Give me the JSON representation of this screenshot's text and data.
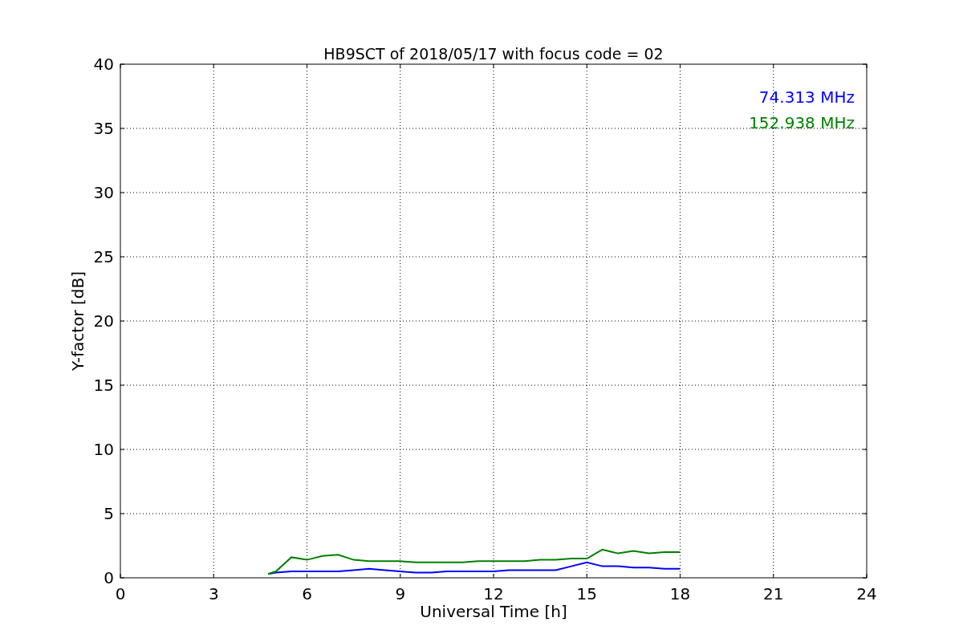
{
  "chart_data": {
    "type": "line",
    "title": "HB9SCT of 2018/05/17 with focus code = 02",
    "xlabel": "Universal Time [h]",
    "ylabel": "Y-factor [dB]",
    "x": [
      4.75,
      5,
      5.5,
      6,
      6.5,
      7,
      7.5,
      8,
      8.5,
      9,
      9.5,
      10,
      10.5,
      11,
      11.5,
      12,
      12.5,
      13,
      13.5,
      14,
      14.5,
      15,
      15.5,
      16,
      16.5,
      17,
      17.5,
      18
    ],
    "series": [
      {
        "name": "74.313 MHz",
        "color": "#0000ff",
        "values": [
          0.3,
          0.4,
          0.5,
          0.5,
          0.5,
          0.5,
          0.6,
          0.7,
          0.6,
          0.5,
          0.4,
          0.4,
          0.5,
          0.5,
          0.5,
          0.5,
          0.6,
          0.6,
          0.6,
          0.6,
          0.9,
          1.2,
          0.9,
          0.9,
          0.8,
          0.8,
          0.7,
          0.7
        ]
      },
      {
        "name": "152.938 MHz",
        "color": "#008000",
        "values": [
          0.3,
          0.5,
          1.6,
          1.4,
          1.7,
          1.8,
          1.4,
          1.3,
          1.3,
          1.3,
          1.2,
          1.2,
          1.2,
          1.2,
          1.3,
          1.3,
          1.3,
          1.3,
          1.4,
          1.4,
          1.5,
          1.5,
          2.2,
          1.9,
          2.1,
          1.9,
          2.0,
          2.0
        ]
      }
    ],
    "grid": true,
    "xlim": [
      0,
      24
    ],
    "ylim": [
      0,
      40
    ],
    "xticks": [
      0,
      3,
      6,
      9,
      12,
      15,
      18,
      21,
      24
    ],
    "yticks": [
      0,
      5,
      10,
      15,
      20,
      25,
      30,
      35,
      40
    ]
  }
}
